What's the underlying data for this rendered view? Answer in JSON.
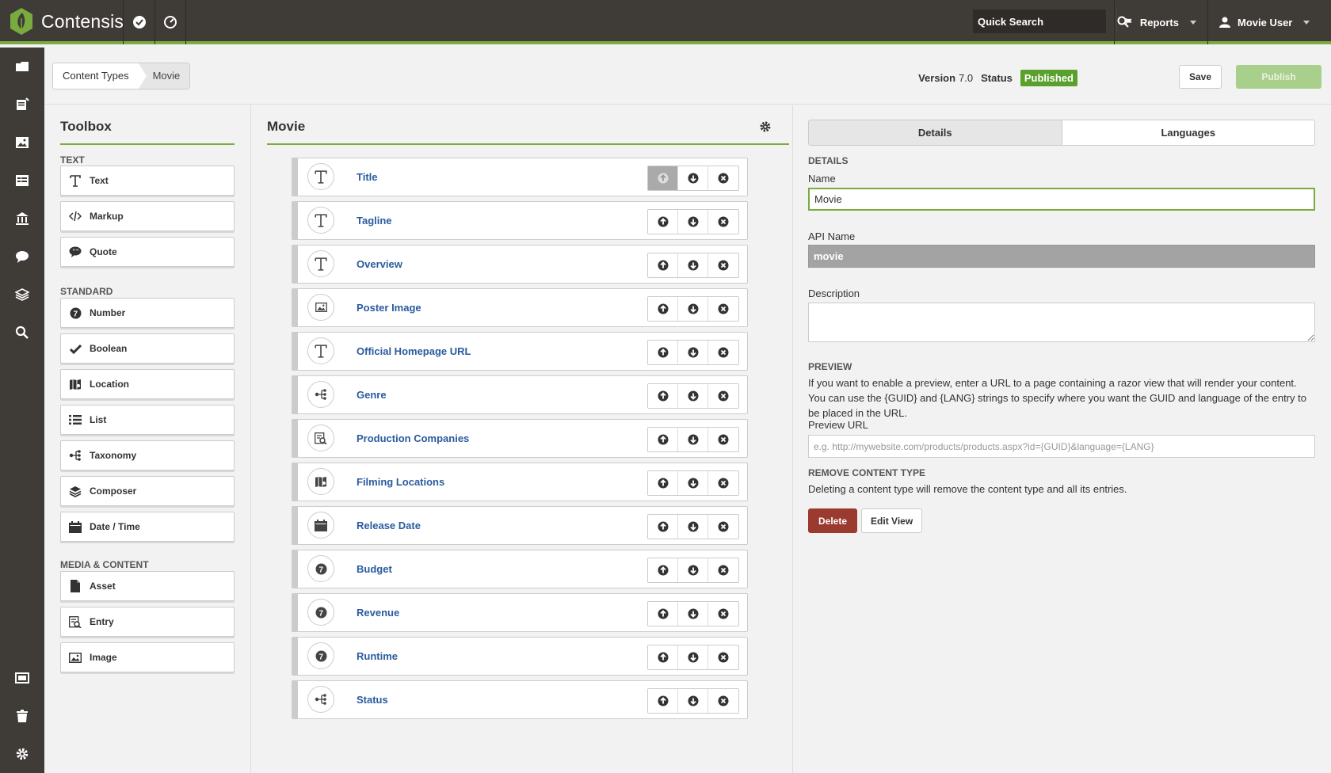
{
  "app": {
    "name": "Contensis"
  },
  "topbar": {
    "quick_search_placeholder": "Quick Search",
    "reports_label": "Reports",
    "user_label": "Movie User"
  },
  "breadcrumb": [
    "Content Types",
    "Movie"
  ],
  "header": {
    "version_label": "Version",
    "version_value": "7.0",
    "status_label": "Status",
    "status_value": "Published",
    "save_label": "Save",
    "publish_label": "Publish"
  },
  "toolbox": {
    "title": "Toolbox",
    "sections": [
      {
        "title": "TEXT",
        "items": [
          {
            "label": "Text",
            "icon": "text-icon"
          },
          {
            "label": "Markup",
            "icon": "code-icon"
          },
          {
            "label": "Quote",
            "icon": "quote-icon"
          }
        ]
      },
      {
        "title": "STANDARD",
        "items": [
          {
            "label": "Number",
            "icon": "number-icon"
          },
          {
            "label": "Boolean",
            "icon": "check-icon"
          },
          {
            "label": "Location",
            "icon": "map-icon"
          },
          {
            "label": "List",
            "icon": "list-icon"
          },
          {
            "label": "Taxonomy",
            "icon": "taxonomy-icon"
          },
          {
            "label": "Composer",
            "icon": "layers-icon"
          },
          {
            "label": "Date / Time",
            "icon": "calendar-icon"
          }
        ]
      },
      {
        "title": "MEDIA & CONTENT",
        "items": [
          {
            "label": "Asset",
            "icon": "asset-icon"
          },
          {
            "label": "Entry",
            "icon": "entry-icon"
          },
          {
            "label": "Image",
            "icon": "image-icon"
          }
        ]
      }
    ]
  },
  "content_type": {
    "title": "Movie",
    "fields": [
      {
        "name": "Title",
        "icon": "text-icon"
      },
      {
        "name": "Tagline",
        "icon": "text-icon"
      },
      {
        "name": "Overview",
        "icon": "text-icon"
      },
      {
        "name": "Poster Image",
        "icon": "image-icon"
      },
      {
        "name": "Official Homepage URL",
        "icon": "text-icon"
      },
      {
        "name": "Genre",
        "icon": "taxonomy-icon"
      },
      {
        "name": "Production Companies",
        "icon": "entry-icon"
      },
      {
        "name": "Filming Locations",
        "icon": "map-icon"
      },
      {
        "name": "Release Date",
        "icon": "calendar-icon"
      },
      {
        "name": "Budget",
        "icon": "number-icon"
      },
      {
        "name": "Revenue",
        "icon": "number-icon"
      },
      {
        "name": "Runtime",
        "icon": "number-icon"
      },
      {
        "name": "Status",
        "icon": "taxonomy-icon"
      }
    ]
  },
  "details": {
    "tabs": [
      "Details",
      "Languages"
    ],
    "section_details": "DETAILS",
    "name_label": "Name",
    "name_value": "Movie",
    "api_name_label": "API Name",
    "api_name_value": "movie",
    "description_label": "Description",
    "section_preview": "PREVIEW",
    "preview_text": "If you want to enable a preview, enter a URL to a page containing a razor view that will render your content. You can use the {GUID} and {LANG} strings to specify where you want the GUID and language of the entry to be placed in the URL.",
    "preview_url_label": "Preview URL",
    "preview_url_placeholder": "e.g. http://mywebsite.com/products/products.aspx?id={GUID}&language={LANG}",
    "section_remove": "REMOVE CONTENT TYPE",
    "remove_text": "Deleting a content type will remove the content type and all its entries.",
    "delete_label": "Delete",
    "edit_view_label": "Edit View"
  },
  "colors": {
    "accent": "#7aab3e",
    "topbar": "#3f3b37",
    "link": "#2a5b9e",
    "danger": "#9b3a2e"
  }
}
